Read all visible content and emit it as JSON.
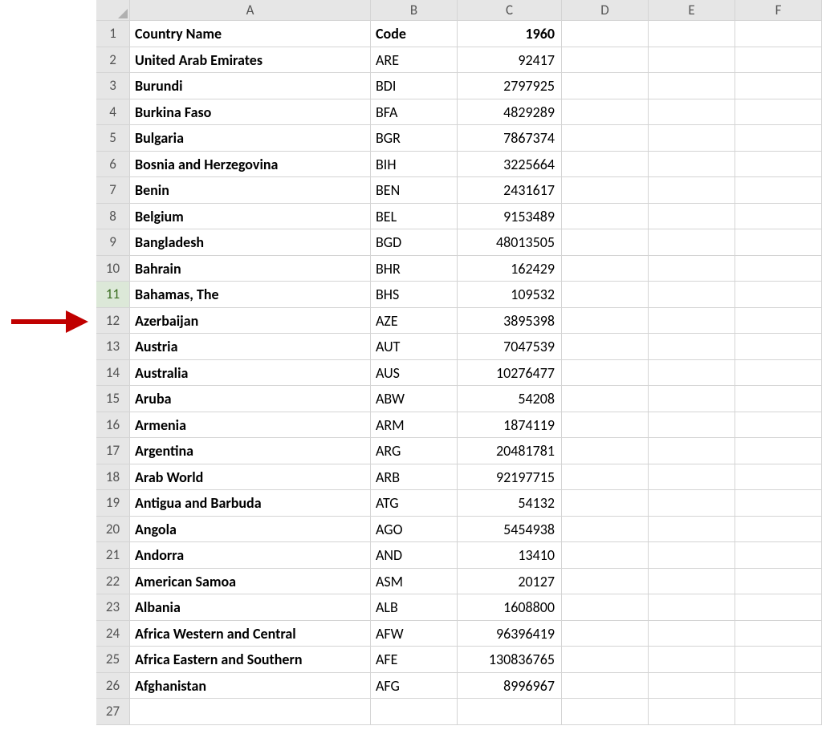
{
  "columns": [
    "A",
    "B",
    "C",
    "D",
    "E",
    "F"
  ],
  "highlighted_row_header": 11,
  "table": {
    "header": {
      "A": "Country Name",
      "B": "Code",
      "C": "1960"
    },
    "rows": [
      {
        "n": 1,
        "A": "Country Name",
        "B": "Code",
        "C": "1960",
        "is_header": true
      },
      {
        "n": 2,
        "A": "United Arab Emirates",
        "B": "ARE",
        "C": "92417"
      },
      {
        "n": 3,
        "A": "Burundi",
        "B": "BDI",
        "C": "2797925"
      },
      {
        "n": 4,
        "A": "Burkina Faso",
        "B": "BFA",
        "C": "4829289"
      },
      {
        "n": 5,
        "A": "Bulgaria",
        "B": "BGR",
        "C": "7867374"
      },
      {
        "n": 6,
        "A": "Bosnia and Herzegovina",
        "B": "BIH",
        "C": "3225664"
      },
      {
        "n": 7,
        "A": "Benin",
        "B": "BEN",
        "C": "2431617"
      },
      {
        "n": 8,
        "A": "Belgium",
        "B": "BEL",
        "C": "9153489"
      },
      {
        "n": 9,
        "A": "Bangladesh",
        "B": "BGD",
        "C": "48013505"
      },
      {
        "n": 10,
        "A": "Bahrain",
        "B": "BHR",
        "C": "162429"
      },
      {
        "n": 11,
        "A": "Bahamas, The",
        "B": "BHS",
        "C": "109532"
      },
      {
        "n": 12,
        "A": "Azerbaijan",
        "B": "AZE",
        "C": "3895398"
      },
      {
        "n": 13,
        "A": "Austria",
        "B": "AUT",
        "C": "7047539"
      },
      {
        "n": 14,
        "A": "Australia",
        "B": "AUS",
        "C": "10276477"
      },
      {
        "n": 15,
        "A": "Aruba",
        "B": "ABW",
        "C": "54208"
      },
      {
        "n": 16,
        "A": "Armenia",
        "B": "ARM",
        "C": "1874119"
      },
      {
        "n": 17,
        "A": "Argentina",
        "B": "ARG",
        "C": "20481781"
      },
      {
        "n": 18,
        "A": "Arab World",
        "B": "ARB",
        "C": "92197715"
      },
      {
        "n": 19,
        "A": "Antigua and Barbuda",
        "B": "ATG",
        "C": "54132"
      },
      {
        "n": 20,
        "A": "Angola",
        "B": "AGO",
        "C": "5454938"
      },
      {
        "n": 21,
        "A": "Andorra",
        "B": "AND",
        "C": "13410"
      },
      {
        "n": 22,
        "A": "American Samoa",
        "B": "ASM",
        "C": "20127"
      },
      {
        "n": 23,
        "A": "Albania",
        "B": "ALB",
        "C": "1608800"
      },
      {
        "n": 24,
        "A": "Africa Western and Central",
        "B": "AFW",
        "C": "96396419"
      },
      {
        "n": 25,
        "A": "Africa Eastern and Southern",
        "B": "AFE",
        "C": "130836765"
      },
      {
        "n": 26,
        "A": "Afghanistan",
        "B": "AFG",
        "C": "8996967"
      },
      {
        "n": 27,
        "A": "",
        "B": "",
        "C": ""
      }
    ]
  },
  "annotation": {
    "arrow_color": "#c00000",
    "points_between_rows": [
      11,
      12
    ]
  }
}
